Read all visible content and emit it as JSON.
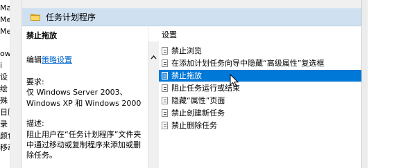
{
  "left_pane": {
    "fragments": [
      "Mai",
      "Mec",
      "Mes",
      "ow",
      "i",
      "设",
      "绘",
      "殊",
      "日历",
      "录",
      "颜色",
      "移动"
    ]
  },
  "header": {
    "title": "任务计划程序",
    "icon": "folder-icon"
  },
  "description": {
    "policy_title": "禁止拖放",
    "edit_prefix": "编辑",
    "edit_link": "策略设置",
    "requirements_label": "要求:",
    "requirements_lines": [
      "仅 Windows Server 2003、",
      "Windows XP 和 Windows 2000"
    ],
    "description_label": "描述:",
    "description_lines": [
      "阻止用户在“任务计划程序”文件夹",
      "中通过移动或复制程序来添加或删",
      "除任务。"
    ]
  },
  "settings": {
    "header": "设置",
    "items": [
      {
        "label": "禁止浏览",
        "icon": "policy-setting-icon",
        "selected": false
      },
      {
        "label": "在添加计划任务向导中隐藏“高级属性”复选框",
        "icon": "policy-setting-icon",
        "selected": false
      },
      {
        "label": "禁止拖放",
        "icon": "policy-setting-icon",
        "selected": true
      },
      {
        "label": "阻止任务运行或结束",
        "icon": "policy-setting-icon",
        "selected": false
      },
      {
        "label": "隐藏“属性”页面",
        "icon": "policy-setting-icon",
        "selected": false
      },
      {
        "label": "禁止创建新任务",
        "icon": "policy-setting-icon",
        "selected": false
      },
      {
        "label": "禁止删除任务",
        "icon": "policy-setting-icon",
        "selected": false
      }
    ]
  },
  "colors": {
    "header_bg": "#cfe0f1",
    "selection": "#0078d7",
    "link": "#0066cc"
  }
}
